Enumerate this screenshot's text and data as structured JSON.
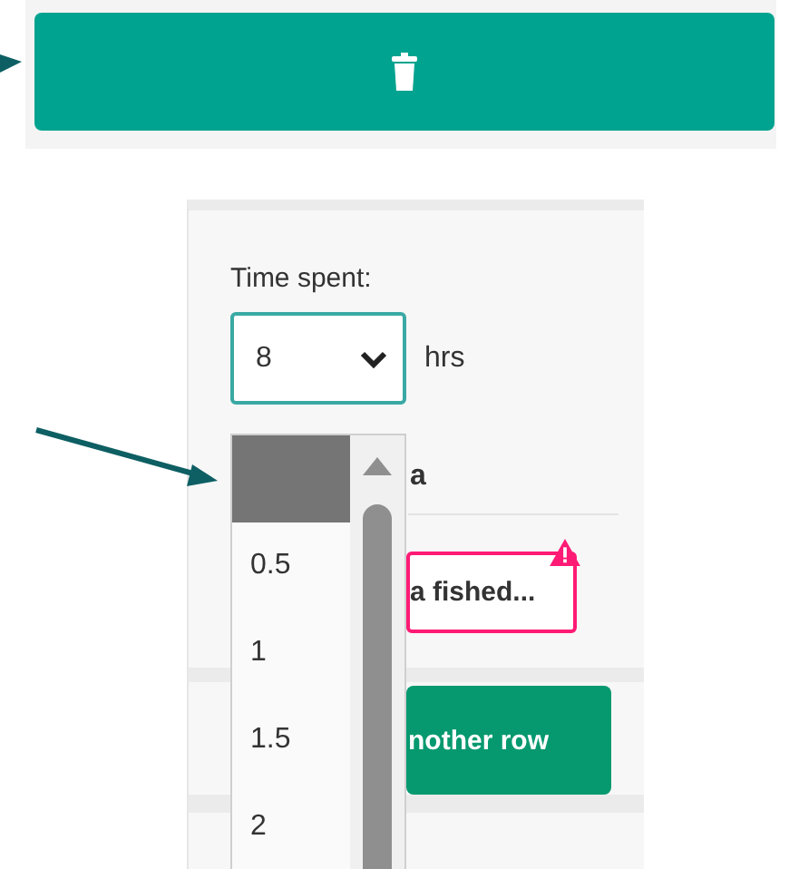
{
  "time_spent": {
    "label": "Time spent:",
    "value": "8",
    "unit": "hrs"
  },
  "dropdown": {
    "options": [
      {
        "kind": "blank",
        "selected": true
      },
      {
        "kind": "value",
        "label": "0.5",
        "selected": false
      },
      {
        "kind": "value",
        "label": "1",
        "selected": false
      },
      {
        "kind": "value",
        "label": "1.5",
        "selected": false
      },
      {
        "kind": "value",
        "label": "2",
        "selected": false
      }
    ]
  },
  "row_label": "a",
  "catch_field": {
    "value": "a fished...",
    "invalid": true
  },
  "add_row_button": {
    "label": "nother row"
  }
}
